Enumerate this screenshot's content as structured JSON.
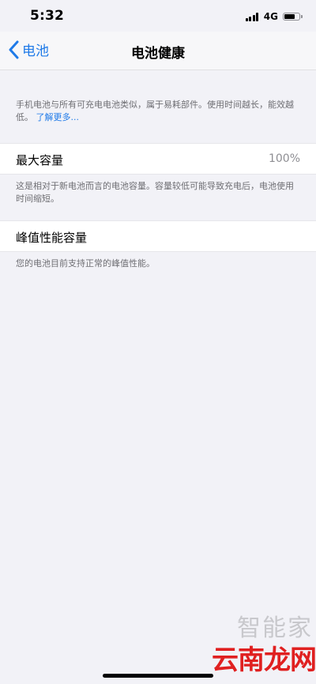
{
  "status_bar": {
    "time": "5:32",
    "network": "4G",
    "battery_level": 0.7
  },
  "nav": {
    "back_label": "电池",
    "title": "电池健康"
  },
  "intro": {
    "text": "手机电池与所有可充电电池类似，属于易耗部件。使用时间越长，能效越低。",
    "learn_more": "了解更多..."
  },
  "max_capacity": {
    "label": "最大容量",
    "value": "100%",
    "description": "这是相对于新电池而言的电池容量。容量较低可能导致充电后，电池使用时间缩短。"
  },
  "peak_performance": {
    "label": "峰值性能容量",
    "description": "您的电池目前支持正常的峰值性能。"
  },
  "watermark": {
    "brand": "云南龙网",
    "secondary": "智能家"
  },
  "colors": {
    "accent": "#1f7ae8",
    "background": "#f2f2f7",
    "watermark": "#e02020"
  }
}
